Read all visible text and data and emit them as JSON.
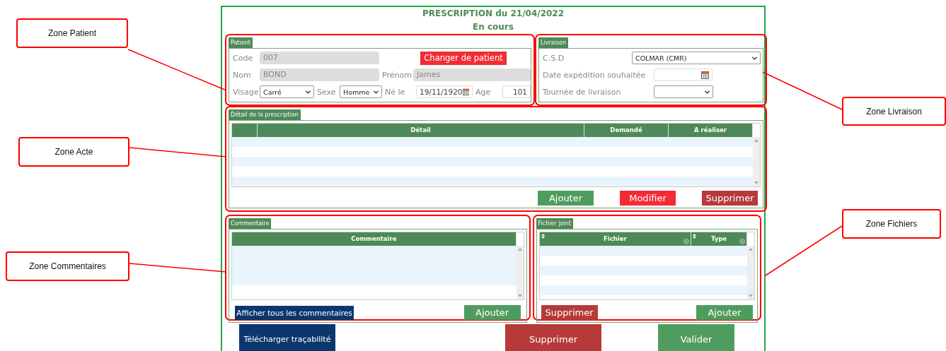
{
  "header": {
    "title": "PRESCRIPTION du 21/04/2022",
    "status": "En cours"
  },
  "patient": {
    "tab": "Patient",
    "code_label": "Code",
    "code": "007",
    "change_button": "Changer de patient",
    "nom_label": "Nom",
    "nom": "BOND",
    "prenom_label": "Prénom",
    "prenom": "James",
    "visage_label": "Visage",
    "visage": "Carré",
    "sexe_label": "Sexe",
    "sexe": "Homme",
    "ne_le_label": "Né le",
    "ne_le": "19/11/1920",
    "age_label": "Age",
    "age": "101"
  },
  "livraison": {
    "tab": "Livraison",
    "csd_label": "C.S.D",
    "csd": "COLMAR (CMR)",
    "date_label": "Date expédition souhaitée",
    "tournee_label": "Tournée de livraison"
  },
  "detail": {
    "tab": "Détail de la prescription",
    "columns": [
      "Détail",
      "Demandé",
      "A réaliser"
    ],
    "buttons": [
      {
        "label": "Ajouter",
        "kind": "add"
      },
      {
        "label": "Modifier",
        "kind": "edit"
      },
      {
        "label": "Supprimer",
        "kind": "delete"
      }
    ]
  },
  "commentaire": {
    "tab": "Commentaire",
    "columns": [
      "Commentaire"
    ],
    "show_all_button": "Afficher tous les commentaires",
    "add_button": "Ajouter"
  },
  "fichiers": {
    "tab": "Fichier joint",
    "columns": [
      "Fichier",
      "Type"
    ],
    "delete_button": "Supprimer",
    "add_button": "Ajouter"
  },
  "footer": {
    "buttons": [
      {
        "label": "Télécharger traçabilité",
        "kind": "download"
      },
      {
        "label": "Supprimer",
        "kind": "delete"
      },
      {
        "label": "Valider",
        "kind": "validate"
      }
    ]
  },
  "annotations": [
    {
      "label": "Zone Patient"
    },
    {
      "label": "Zone Acte"
    },
    {
      "label": "Zone Commentaires"
    },
    {
      "label": "Zone Livraison"
    },
    {
      "label": "Zone Fichiers"
    }
  ]
}
